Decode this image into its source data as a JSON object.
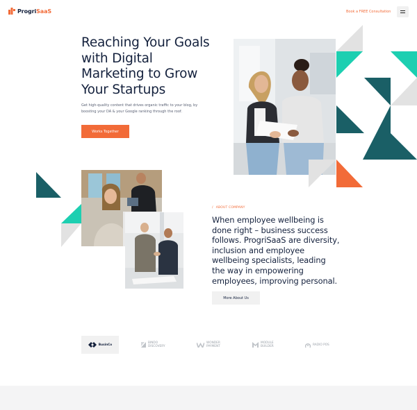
{
  "header": {
    "logo_text_main": "Progri",
    "logo_text_accent": "SaaS",
    "cta_label": "Book a FREE Consultation",
    "menu_icon": "hamburger-menu-icon"
  },
  "hero": {
    "title": "Reaching Your Goals with Digital Marketing to Grow Your Startups",
    "subtitle": "Get high-quality content that drives organic traffic to your blog, by boosting your DA & your Google ranking through the roof.",
    "button_label": "Works Together"
  },
  "about": {
    "eyebrow_slash": "/",
    "eyebrow_label": "ABOUT COMPANY",
    "text": "When employee wellbeing is done right – business success follows. ProgriSaaS are diversity, inclusion and employee wellbeing specialists, leading the way in empowering employees, improving personal.",
    "button_label": "More About Us"
  },
  "partners": [
    {
      "name": "BusinCo",
      "icon": "businco-logo-icon"
    },
    {
      "name": "BINDO DISCOVERY",
      "icon": "bindo-logo-icon"
    },
    {
      "name": "WONDER PAYMENT",
      "icon": "wonder-logo-icon"
    },
    {
      "name": "MODULE BUILDER",
      "icon": "module-logo-icon"
    },
    {
      "name": "RADIO POS",
      "icon": "radio-logo-icon"
    }
  ],
  "colors": {
    "accent": "#f26b38",
    "navy": "#14213d",
    "teal": "#1a5f66",
    "aqua": "#1dcfb1"
  }
}
